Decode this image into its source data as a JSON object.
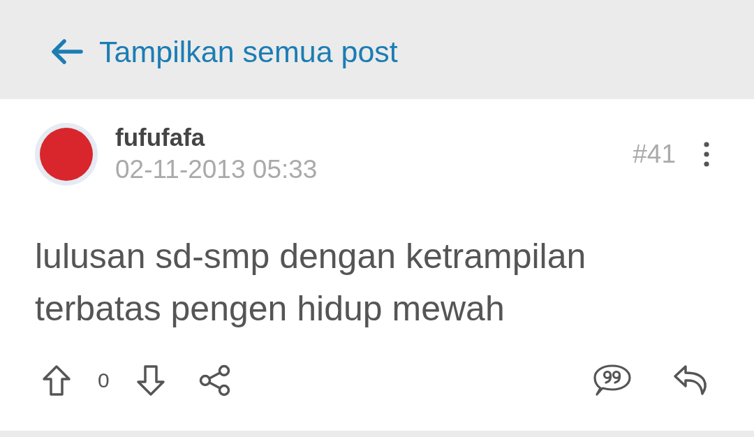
{
  "header": {
    "back_link": "Tampilkan semua post"
  },
  "post": {
    "author": "fufufafa",
    "timestamp": "02-11-2013 05:33",
    "number": "#41",
    "body": "lulusan sd-smp dengan ketrampilan terbatas pengen hidup mewah",
    "score": "0"
  }
}
